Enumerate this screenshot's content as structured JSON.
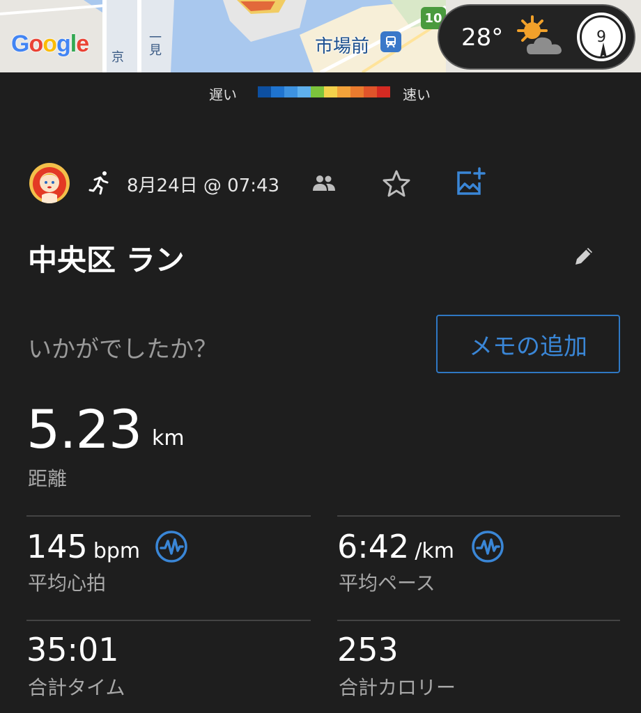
{
  "map": {
    "logo_letters": [
      "G",
      "o",
      "o",
      "g",
      "l",
      "e"
    ],
    "station_label": "市場前",
    "station_icon": "train-icon",
    "route_badge": "10",
    "road_text_1": "京",
    "road_text_2": "一見"
  },
  "weather": {
    "temperature": "28°",
    "icon": "partly-cloudy-icon",
    "compass_value": "9"
  },
  "legend": {
    "slow": "遅い",
    "fast": "速い",
    "colors": [
      "#0d4fa0",
      "#1f74d0",
      "#3d92e0",
      "#5fb0ec",
      "#7cc43c",
      "#f3d14b",
      "#f2a23a",
      "#ea7b2e",
      "#e0542a",
      "#d42a22"
    ]
  },
  "activity": {
    "type_icon": "running-icon",
    "date": "8月24日 @ 07:43",
    "title": "中央区 ラン",
    "prompt": "いかがでしたか？",
    "memo_button": "メモの追加"
  },
  "stats": {
    "distance": {
      "value": "5.23",
      "unit": "km",
      "label": "距離"
    },
    "avg_hr": {
      "value": "145",
      "unit": "bpm",
      "label": "平均心拍"
    },
    "avg_pace": {
      "value": "6:42",
      "unit": "/km",
      "label": "平均ペース"
    },
    "total_time": {
      "value": "35:01",
      "label": "合計タイム"
    },
    "calories": {
      "value": "253",
      "label": "合計カロリー"
    }
  },
  "colors": {
    "accent": "#3a86d6",
    "background": "#1e1e1e",
    "label": "#a8a8a8"
  }
}
